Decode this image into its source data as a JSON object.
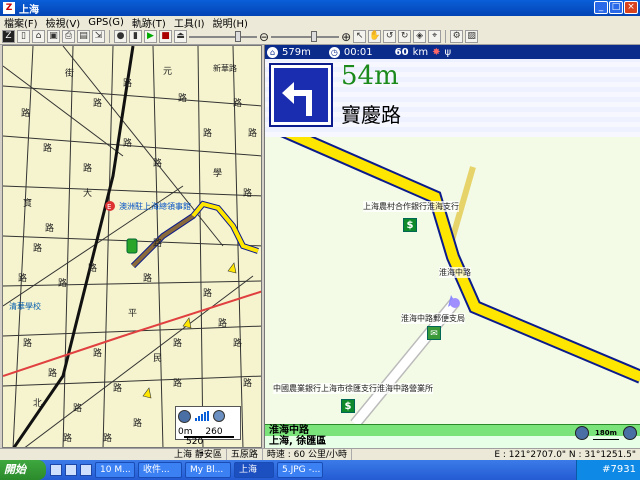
{
  "window": {
    "title": "上海",
    "app_icon": "Z"
  },
  "menu": [
    "檔案(F)",
    "檢視(V)",
    "GPS(G)",
    "軌跡(T)",
    "工具(I)",
    "說明(H)"
  ],
  "toolbar": {
    "zoom_out_label": "⊖",
    "zoom_in_label": "⊕"
  },
  "left_map": {
    "poi_label": "澳洲駐上海總領事館",
    "school_label": "清華學校",
    "poi_marker": "E",
    "road_chars": [
      "路",
      "路",
      "街",
      "路",
      "寶",
      "路",
      "元",
      "新華路",
      "路",
      "路",
      "路",
      "路",
      "學",
      "路",
      "路",
      "路",
      "路",
      "平",
      "路",
      "路",
      "路",
      "路",
      "路",
      "路",
      "路",
      "路",
      "民",
      "路",
      "路",
      "路",
      "路",
      "路",
      "北",
      "路",
      "路",
      "路",
      "路",
      "路",
      "大",
      "路",
      "路",
      "路"
    ],
    "scale": {
      "left": "0m",
      "mid": "260",
      "right": "520"
    }
  },
  "nav": {
    "status": {
      "distance_total": "579m",
      "time": "00:01",
      "speed": "60",
      "speed_unit": "km"
    },
    "distance": "54m",
    "street": "寶慶路",
    "labels": {
      "bank1": "上海農村合作銀行淮海支行",
      "road1": "淮海中路",
      "post": "淮海中路郵便支局",
      "bank2": "中國農業銀行上海市徐匯支行淮海中路營業所"
    },
    "current_road": "淮海中路",
    "location": "上海, 徐匯區",
    "mini_scale": "180m"
  },
  "statusbar": {
    "cell1": "上海 靜安區",
    "cell2": "五原路",
    "cell3": "時速 : 60 公里/小時",
    "coords": "E : 121°2707.0\"   N : 31°1251.5\""
  },
  "taskbar": {
    "start": "開始",
    "tasks": [
      "10 M...",
      "收件...",
      "My Bl...",
      "上海",
      "5.JPG -..."
    ],
    "clock": "#7931"
  },
  "colors": {
    "route": "#ffe600",
    "route_outline": "#0b1b8c",
    "traveled": "#8a6a3a",
    "map_bg": "#f6f4ce"
  }
}
